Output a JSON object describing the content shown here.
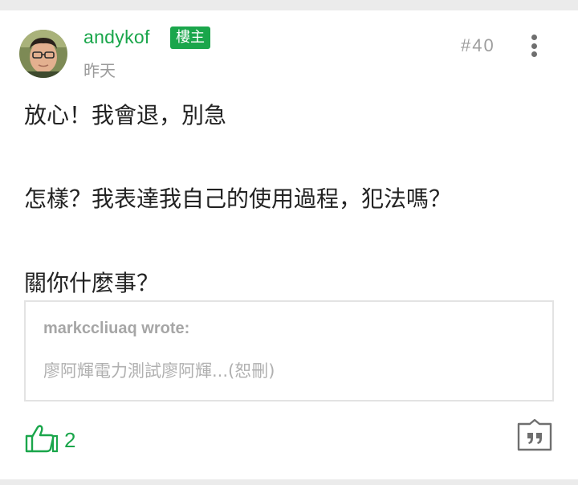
{
  "post": {
    "author": "andykof",
    "op_badge": "樓主",
    "time": "昨天",
    "floor": "#40",
    "body_lines": [
      "放心！我會退，別急",
      "怎樣？我表達我自己的使用過程，犯法嗎？",
      "關你什麼事？"
    ],
    "quote": {
      "author": "markccliuaq wrote:",
      "text": "廖阿輝電力測試廖阿輝...(恕刪)"
    },
    "like_count": "2"
  },
  "icons": {
    "avatar": "user-avatar-photo",
    "more": "more-vertical-icon",
    "like": "thumbs-up-icon",
    "quote": "quote-reply-icon"
  },
  "colors": {
    "accent": "#1aa64b",
    "muted": "#9b9b9b",
    "border": "#e3e3e3"
  }
}
